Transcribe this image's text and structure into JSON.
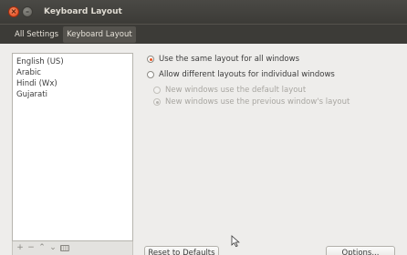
{
  "window": {
    "title": "Keyboard Layout",
    "close_glyph": "×",
    "minimize_glyph": "–"
  },
  "breadcrumb": {
    "items": [
      {
        "label": "All Settings"
      },
      {
        "label": "Keyboard Layout"
      }
    ]
  },
  "layouts": {
    "items": [
      {
        "label": "English (US)"
      },
      {
        "label": "Arabic"
      },
      {
        "label": "Hindi (Wx)"
      },
      {
        "label": "Gujarati"
      }
    ],
    "toolbar": {
      "add": "+",
      "remove": "−",
      "move_up": "⌃",
      "move_down": "⌄"
    }
  },
  "options": {
    "same_layout": {
      "label": "Use the same layout for all windows",
      "selected": true
    },
    "different_layouts": {
      "label": "Allow different layouts for individual windows",
      "selected": false
    },
    "new_default": {
      "label": "New windows use the default layout",
      "selected": false,
      "enabled": false
    },
    "new_previous": {
      "label": "New windows use the previous window's layout",
      "selected": true,
      "enabled": false
    }
  },
  "buttons": {
    "reset": "Reset to Defaults",
    "options": "Options..."
  },
  "colors": {
    "accent": "#e95420",
    "titlebar": "#3c3b37"
  }
}
